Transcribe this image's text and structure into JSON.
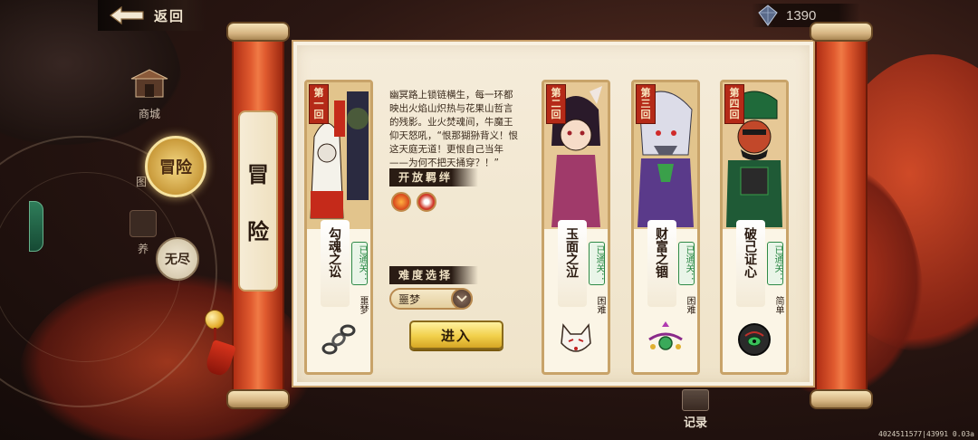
{
  "header": {
    "back_label": "返回",
    "currency_value": "1390",
    "currency_icon": "gem-icon"
  },
  "nav": {
    "shop_label": "商城",
    "adventure_label": "冒险",
    "adventure_side_label": "图",
    "raise_label": "养",
    "endless_label": "无尽"
  },
  "scroll": {
    "title_chars": [
      "冒",
      "险"
    ]
  },
  "chapters": [
    {
      "chapter": "第一回",
      "name": "勾魂之讼",
      "status": "已通关：",
      "difficulty": "噩梦",
      "item": "chain-icon"
    },
    {
      "chapter": "第二回",
      "name": "玉面之泣",
      "status": "已通关：",
      "difficulty": "困难",
      "item": "fox-mask-icon"
    },
    {
      "chapter": "第三回",
      "name": "财富之锢",
      "status": "已通关：",
      "difficulty": "困难",
      "item": "jade-pendant-icon"
    },
    {
      "chapter": "第四回",
      "name": "破己证心",
      "status": "已通关：",
      "difficulty": "简单",
      "item": "dark-orb-icon"
    }
  ],
  "detail": {
    "description": "幽冥路上锁链横生，每一环都映出火焰山炽热与花果山哲言的残影。业火焚魂间，牛魔王仰天怒吼，“恨那猢狲背义！恨这天庭无道！更恨自己当年——为何不把天捅穿？！”",
    "open_affix_label": "开放羁绊",
    "difficulty_label": "难度选择",
    "difficulty_value": "噩梦",
    "enter_label": "进入"
  },
  "footer": {
    "record_label": "记录",
    "debug_text": "4024511577|43991 0.03a"
  },
  "colors": {
    "scroll_red": "#e05a2f",
    "paper": "#f5ecda",
    "cleared_green": "#2f8a48",
    "enter_button": "#f1cf4a"
  }
}
